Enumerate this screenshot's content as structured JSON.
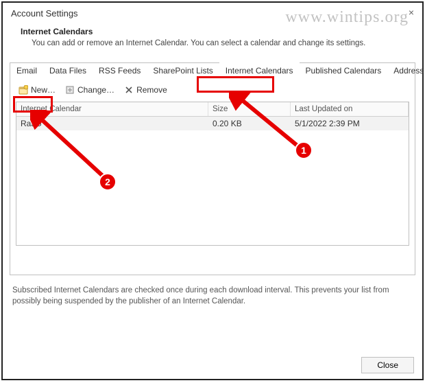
{
  "window": {
    "title": "Account Settings",
    "close_glyph": "×"
  },
  "section": {
    "heading": "Internet Calendars",
    "desc": "You can add or remove an Internet Calendar. You can select a calendar and change its settings."
  },
  "tabs": {
    "email": "Email",
    "data_files": "Data Files",
    "rss": "RSS Feeds",
    "sharepoint": "SharePoint Lists",
    "internet_cal": "Internet Calendars",
    "published": "Published Calendars",
    "address": "Address Books"
  },
  "toolbar": {
    "new_label": "New…",
    "change_label": "Change…",
    "remove_label": "Remove"
  },
  "list": {
    "headers": {
      "name": "Internet Calendar",
      "size": "Size",
      "updated": "Last Updated on"
    },
    "rows": [
      {
        "name": "RaJG",
        "size": "0.20 KB",
        "updated": "5/1/2022 2:39 PM"
      }
    ]
  },
  "footer_note": "Subscribed Internet Calendars are checked once during each download interval. This prevents your list from possibly being suspended by the publisher of an Internet Calendar.",
  "buttons": {
    "close": "Close"
  },
  "annotations": {
    "badge1": "1",
    "badge2": "2"
  },
  "watermark": "www.wintips.org"
}
